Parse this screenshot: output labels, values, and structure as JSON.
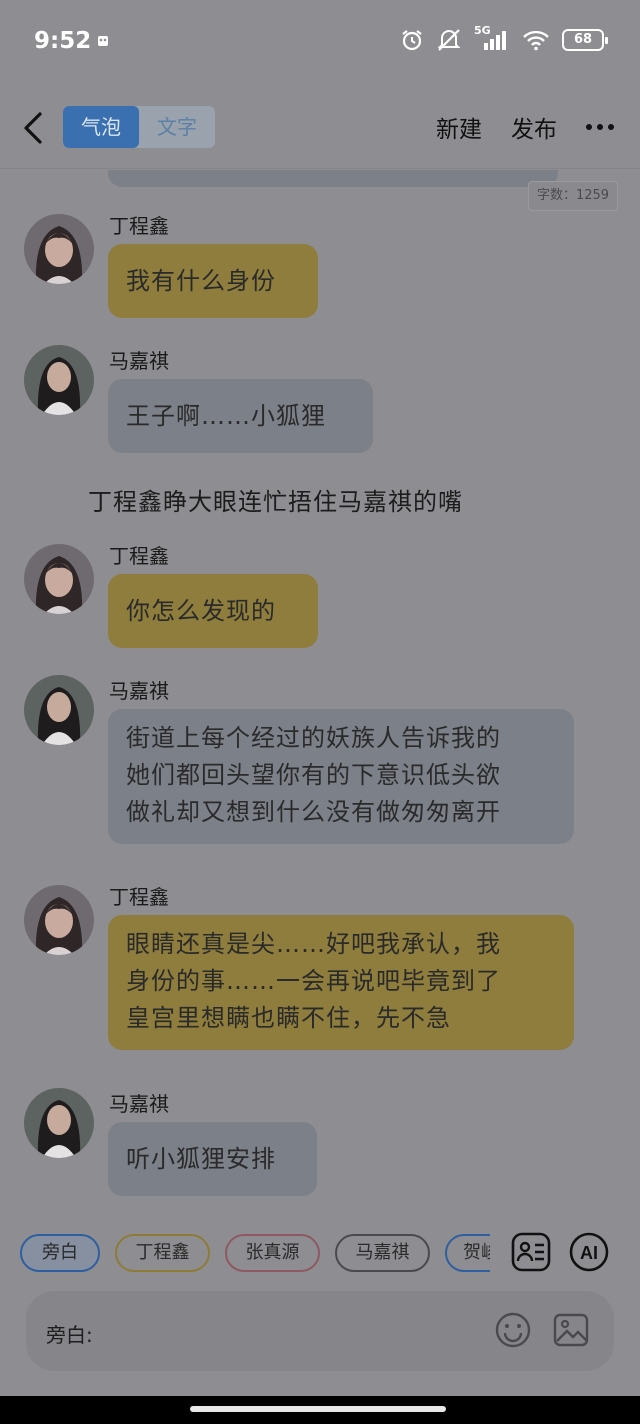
{
  "status_bar": {
    "time": "9:52",
    "network": "5G",
    "battery": "68"
  },
  "header": {
    "tabs": [
      {
        "label": "气泡",
        "active": true
      },
      {
        "label": "文字",
        "active": false
      }
    ],
    "new_label": "新建",
    "publish_label": "发布"
  },
  "word_count": "字数：1259",
  "messages": [
    {
      "speaker": "丁程鑫",
      "text": "我有什么身份",
      "color": "yellow"
    },
    {
      "speaker": "马嘉祺",
      "text": "王子啊……小狐狸",
      "color": "gray"
    },
    {
      "narration": "丁程鑫睁大眼连忙捂住马嘉祺的嘴"
    },
    {
      "speaker": "丁程鑫",
      "text": "你怎么发现的",
      "color": "yellow"
    },
    {
      "speaker": "马嘉祺",
      "lines": [
        "街道上每个经过的妖族人告诉我的",
        "她们都回头望你有的下意识低头欲",
        "做礼却又想到什么没有做匆匆离开"
      ],
      "color": "gray"
    },
    {
      "speaker": "丁程鑫",
      "lines": [
        "眼睛还真是尖……好吧我承认，我",
        "身份的事……一会再说吧毕竟到了",
        "皇宫里想瞒也瞒不住，先不急"
      ],
      "color": "yellow"
    },
    {
      "speaker": "马嘉祺",
      "text": "听小狐狸安排",
      "color": "gray"
    }
  ],
  "characters": [
    "旁白",
    "丁程鑫",
    "张真源",
    "马嘉祺",
    "贺峻"
  ],
  "input": {
    "label": "旁白:"
  },
  "colors": {
    "yellow_bubble": "#8e7d3c",
    "gray_bubble": "#7c8088",
    "accent": "#3a6fb0"
  }
}
